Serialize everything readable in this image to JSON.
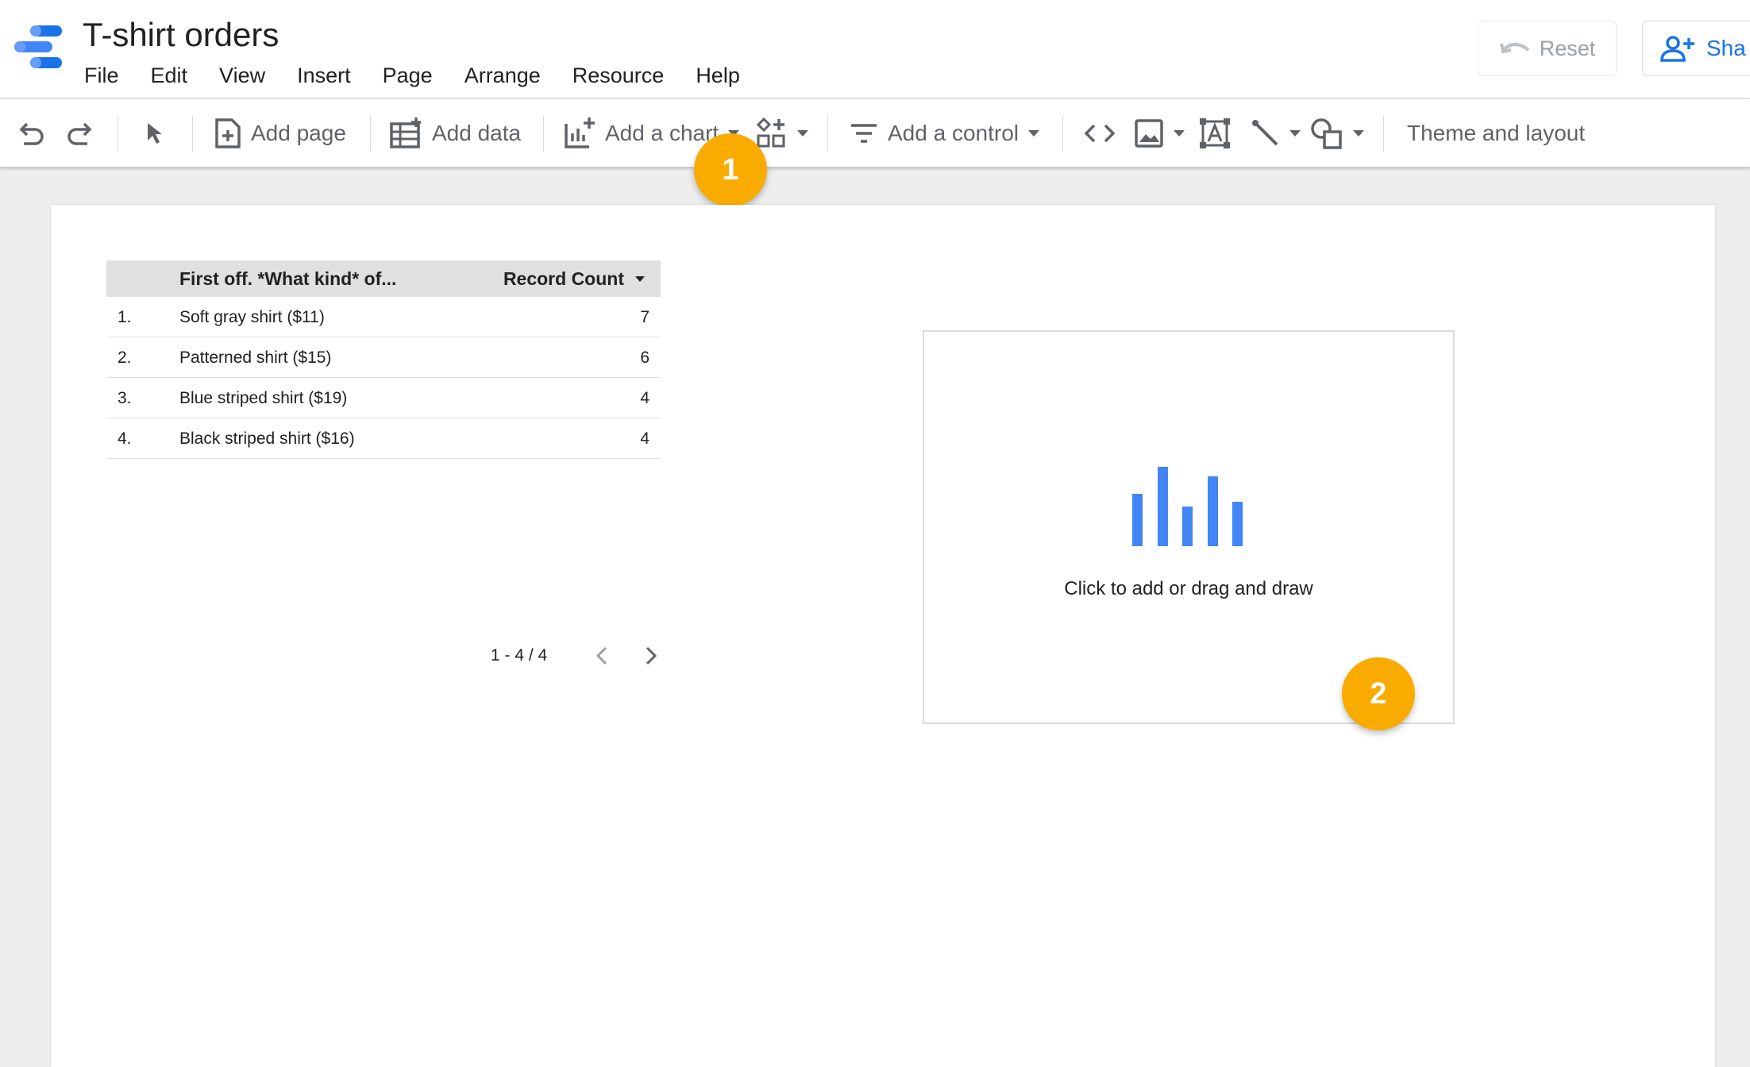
{
  "app": {
    "title": "T-shirt orders"
  },
  "menu": [
    "File",
    "Edit",
    "View",
    "Insert",
    "Page",
    "Arrange",
    "Resource",
    "Help"
  ],
  "header_actions": {
    "reset_label": "Reset",
    "share_label": "Sha"
  },
  "toolbar": {
    "add_page": "Add page",
    "add_data": "Add data",
    "add_chart": "Add a chart",
    "add_control": "Add a control",
    "theme_layout": "Theme and layout"
  },
  "table": {
    "headers": {
      "dimension": "First off. *What kind* of...",
      "metric": "Record Count"
    },
    "rows": [
      {
        "index": "1.",
        "name": "Soft gray shirt ($11)",
        "count": "7"
      },
      {
        "index": "2.",
        "name": "Patterned shirt ($15)",
        "count": "6"
      },
      {
        "index": "3.",
        "name": "Blue striped shirt ($19)",
        "count": "4"
      },
      {
        "index": "4.",
        "name": "Black striped shirt ($16)",
        "count": "4"
      }
    ],
    "pagination": "1 - 4 / 4"
  },
  "placeholder": {
    "text": "Click to add or drag and draw"
  },
  "callouts": [
    "1",
    "2"
  ],
  "colors": {
    "accent": "#1a73e8",
    "badge": "#f9ab00",
    "chart_bar": "#4285f4"
  }
}
